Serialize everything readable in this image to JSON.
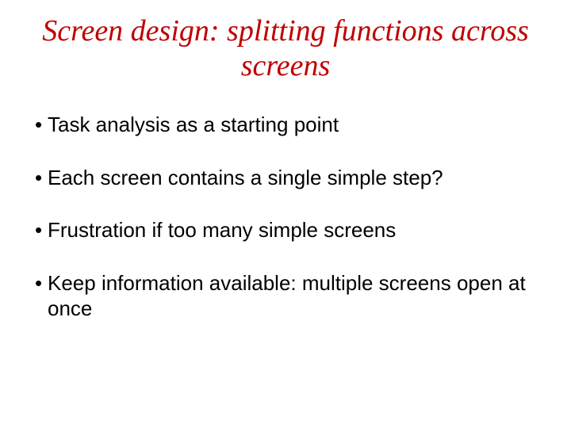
{
  "title": "Screen design: splitting functions across screens",
  "bullets": [
    "Task analysis as a starting point",
    "Each screen contains a single simple step?",
    "Frustration if too many simple screens",
    "Keep information available: multiple screens open at once"
  ]
}
